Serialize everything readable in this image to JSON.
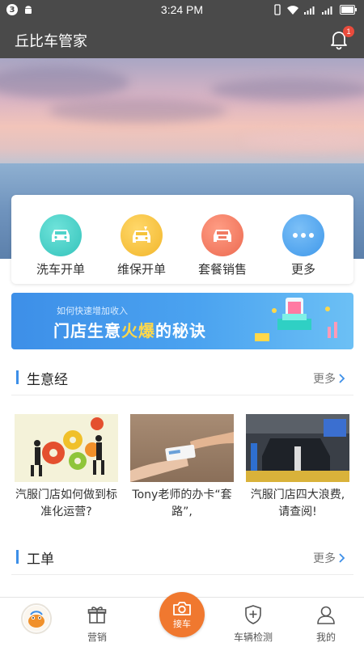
{
  "status_bar": {
    "notification_count": "3",
    "time": "3:24 PM",
    "icons": [
      "android-icon",
      "vibrate-icon",
      "wifi-icon",
      "signal-icon",
      "signal-icon",
      "battery-icon"
    ]
  },
  "header": {
    "title": "丘比车管家",
    "notification_badge": "1"
  },
  "quick_actions": [
    {
      "label": "洗车开单",
      "icon": "car-wash-icon",
      "color": "#3dcfc6"
    },
    {
      "label": "维保开单",
      "icon": "car-repair-icon",
      "color": "#f5c33a"
    },
    {
      "label": "套餐销售",
      "icon": "car-package-icon",
      "color": "#f07a61"
    },
    {
      "label": "更多",
      "icon": "more-icon",
      "color": "#4ea6f0"
    }
  ],
  "promo": {
    "subtitle": "如何快速增加收入",
    "title_start": "门店生意",
    "title_highlight": "火爆",
    "title_end": "的秘诀"
  },
  "business_section": {
    "title": "生意经",
    "more": "更多"
  },
  "articles": [
    {
      "caption": "汽服门店如何做到标准化运营?"
    },
    {
      "caption": "Tony老师的办卡“套路”,"
    },
    {
      "caption": "汽服门店四大浪费,请查阅!"
    }
  ],
  "work_order_section": {
    "title": "工单",
    "more": "更多"
  },
  "bottom_nav": {
    "items": [
      {
        "label": "营销",
        "icon": "gift-icon"
      },
      {
        "label": "接车",
        "icon": "camera-icon"
      },
      {
        "label": "车辆检测",
        "icon": "shield-plus-icon"
      },
      {
        "label": "我的",
        "icon": "user-icon"
      }
    ]
  },
  "colors": {
    "header_bg": "#4a4a4a",
    "accent_blue": "#3d8fe8",
    "scan_orange": "#f0782f",
    "badge_red": "#e94b3c"
  }
}
